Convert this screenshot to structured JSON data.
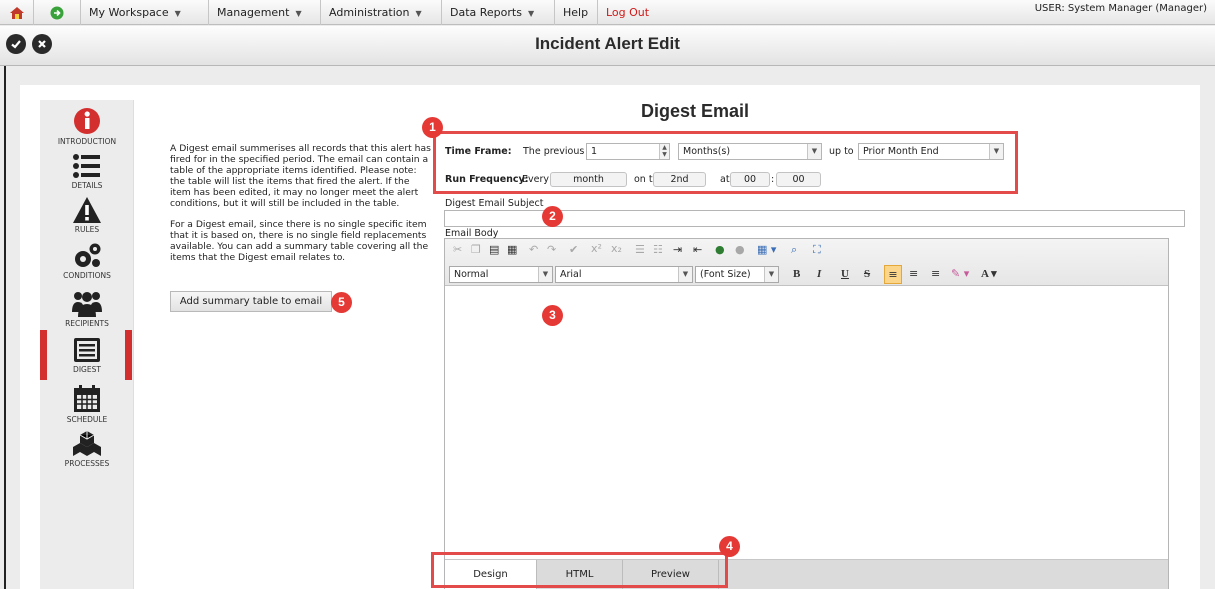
{
  "menu": {
    "workspace": "My Workspace",
    "management": "Management",
    "administration": "Administration",
    "data_reports": "Data Reports",
    "help": "Help",
    "logout": "Log Out",
    "user": "USER: System Manager (Manager)"
  },
  "page": {
    "title": "Incident Alert Edit"
  },
  "sidebar": {
    "items": [
      {
        "label": "INTRODUCTION",
        "icon": "info-icon"
      },
      {
        "label": "DETAILS",
        "icon": "list-icon"
      },
      {
        "label": "RULES",
        "icon": "warning-icon"
      },
      {
        "label": "CONDITIONS",
        "icon": "gears-icon"
      },
      {
        "label": "RECIPIENTS",
        "icon": "users-icon"
      },
      {
        "label": "DIGEST",
        "icon": "digest-icon"
      },
      {
        "label": "SCHEDULE",
        "icon": "calendar-icon"
      },
      {
        "label": "PROCESSES",
        "icon": "cubes-icon"
      }
    ],
    "active": "DIGEST",
    "accent": "#d32f2f"
  },
  "description": {
    "p1": "A Digest email summerises all records that this alert has fired for in the specified period. The email can contain a table of the appropriate items identified. Please note: the table will list the items that fired the alert. If the item has been edited, it may no longer meet the alert conditions, but it will still be included in the table.",
    "p2": "For a Digest email, since there is no single specific item that it is based on, there is no single field replacements available. You can add a summary table covering all the items that the Digest email relates to.",
    "button": "Add summary table to email"
  },
  "digest": {
    "title": "Digest Email",
    "time_frame_label": "Time Frame:",
    "previous_label": "The previous",
    "previous_value": "1",
    "unit_value": "Months(s)",
    "up_to_label": "up to",
    "up_to_value": "Prior Month End",
    "run_frequency_label": "Run Frequency:",
    "every_label": "Every",
    "every_value": "month",
    "on_the_label": "on the",
    "on_the_value": "2nd",
    "at_label": "at",
    "hour_value": "00",
    "colon": ":",
    "minute_value": "00",
    "subject_label": "Digest Email Subject",
    "subject_value": "",
    "body_label": "Email Body"
  },
  "editor": {
    "format_value": "Normal",
    "font_value": "Arial",
    "size_value": "(Font Size)",
    "bold": "B",
    "italic": "I",
    "underline": "U",
    "strike": "S",
    "font_color": "A",
    "tabs": [
      "Design",
      "HTML",
      "Preview"
    ],
    "active_tab": "Design"
  },
  "badges": [
    "1",
    "2",
    "3",
    "4",
    "5"
  ],
  "colors": {
    "highlight": "#e34a4a",
    "badge": "#e53935"
  }
}
